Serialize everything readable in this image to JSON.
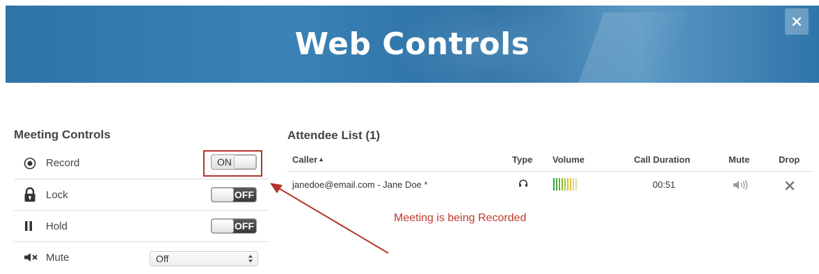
{
  "banner": {
    "title": "Web Controls"
  },
  "meeting_controls": {
    "title": "Meeting Controls",
    "rows": [
      {
        "label": "Record",
        "icon": "record-icon",
        "toggle_label": "ON",
        "state": "on"
      },
      {
        "label": "Lock",
        "icon": "lock-icon",
        "toggle_label": "OFF",
        "state": "off"
      },
      {
        "label": "Hold",
        "icon": "pause-icon",
        "toggle_label": "OFF",
        "state": "off"
      },
      {
        "label": "Mute",
        "icon": "speaker-mute-icon",
        "select_value": "Off"
      }
    ]
  },
  "attendees": {
    "title": "Attendee List (1)",
    "columns": [
      "Caller",
      "Type",
      "Volume",
      "Call Duration",
      "Mute",
      "Drop"
    ],
    "sort_indicator": "▲",
    "rows": [
      {
        "caller": "janedoe@email.com - Jane Doe *",
        "type_icon": "headset-icon",
        "volume_icon": "volume-bars-icon",
        "duration": "00:51",
        "mute_icon": "speaker-icon",
        "drop_icon": "close-icon"
      }
    ]
  },
  "annotation": {
    "text": "Meeting is being Recorded"
  },
  "colors": {
    "banner": "#2f74a6",
    "annotation": "#c0392b",
    "toggle_off": "#444444"
  }
}
